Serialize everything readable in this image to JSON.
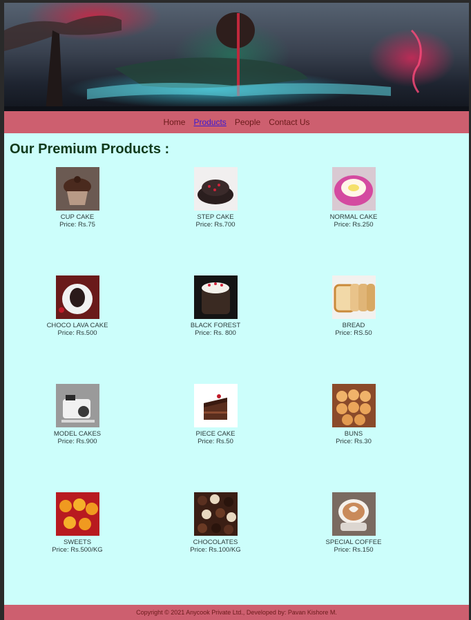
{
  "nav": {
    "items": [
      {
        "label": "Home",
        "active": false
      },
      {
        "label": "Products",
        "active": true
      },
      {
        "label": "People",
        "active": false
      },
      {
        "label": "Contact Us",
        "active": false
      }
    ]
  },
  "page_title": "Our Premium Products :",
  "products": [
    {
      "name": "CUP CAKE",
      "price": "Price: Rs.75"
    },
    {
      "name": "STEP CAKE",
      "price": "Price: Rs.700"
    },
    {
      "name": "NORMAL CAKE",
      "price": "Price: Rs.250"
    },
    {
      "name": "CHOCO LAVA CAKE",
      "price": "Price: Rs.500"
    },
    {
      "name": "BLACK FOREST",
      "price": "Price: Rs. 800"
    },
    {
      "name": "BREAD",
      "price": "Price: RS.50"
    },
    {
      "name": "MODEL CAKES",
      "price": "Price: Rs.900"
    },
    {
      "name": "PIECE CAKE",
      "price": "Price: Rs.50"
    },
    {
      "name": "BUNS",
      "price": "Price: Rs.30"
    },
    {
      "name": "SWEETS",
      "price": "Price: Rs.500/KG"
    },
    {
      "name": "CHOCOLATES",
      "price": "Price: Rs.100/KG"
    },
    {
      "name": "SPECIAL COFFEE",
      "price": "Price: Rs.150"
    }
  ],
  "footer": {
    "text": "Copyright © 2021 Anycook Private Ltd., Developed by: Pavan Kishore M."
  },
  "colors": {
    "nav_bg": "#cd5f6f",
    "page_bg": "#ccfefb",
    "title": "#103a1b",
    "active_link": "#3a1bd0"
  }
}
